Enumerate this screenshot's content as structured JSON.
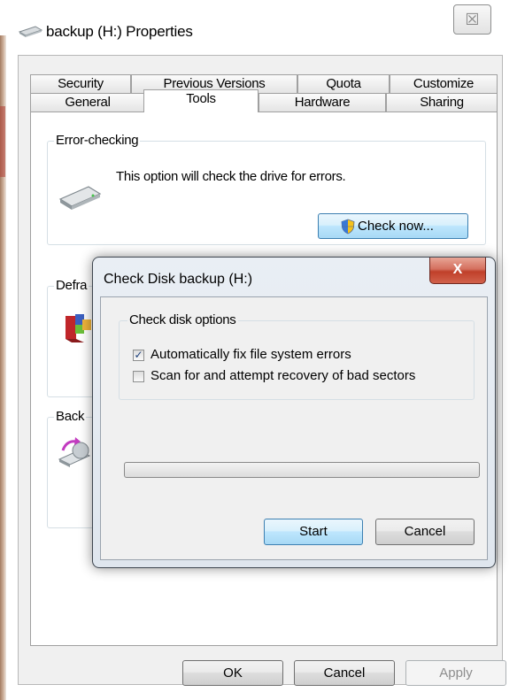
{
  "window": {
    "title": "backup (H:) Properties",
    "close_glyph": "☒",
    "icon": "drive-icon"
  },
  "tabs_row1": [
    {
      "label": "Security"
    },
    {
      "label": "Previous Versions"
    },
    {
      "label": "Quota"
    },
    {
      "label": "Customize"
    }
  ],
  "tabs_row2": [
    {
      "label": "General"
    },
    {
      "label": "Tools",
      "active": true
    },
    {
      "label": "Hardware"
    },
    {
      "label": "Sharing"
    }
  ],
  "error_checking": {
    "label": "Error-checking",
    "description": "This option will check the drive for errors.",
    "button": "Check now...",
    "button_icon": "uac-shield-icon"
  },
  "defrag": {
    "label_partial": "Defra"
  },
  "backup": {
    "label_partial": "Back"
  },
  "footer": {
    "ok": "OK",
    "cancel": "Cancel",
    "apply": "Apply"
  },
  "dialog": {
    "title": "Check Disk backup (H:)",
    "close_glyph": "X",
    "group_label": "Check disk options",
    "options": [
      {
        "label": "Automatically fix file system errors",
        "checked": true
      },
      {
        "label": "Scan for and attempt recovery of bad sectors",
        "checked": false
      }
    ],
    "progress": 0,
    "start": "Start",
    "cancel": "Cancel"
  },
  "colors": {
    "frame_bg": "#f0f0f0",
    "dialog_border": "#3f4750",
    "close_red": "#c0402a",
    "focus_blue": "#3c7fb1"
  }
}
